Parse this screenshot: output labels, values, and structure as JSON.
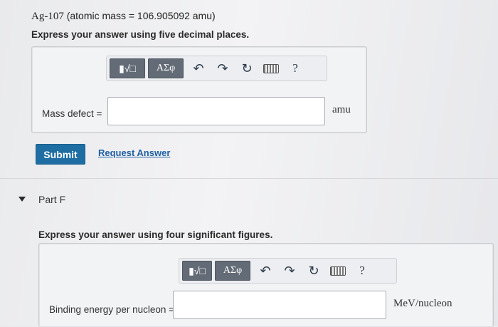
{
  "part_e": {
    "question": {
      "isotope": "Ag-107",
      "mass_text": "(atomic mass = 106.905092 amu)"
    },
    "instruction": "Express your answer using five decimal places.",
    "toolbar": {
      "template_label": "▮√□",
      "greek_label": "AΣφ",
      "help_label": "?"
    },
    "answer": {
      "label": "Mass defect =",
      "value": "",
      "unit": "amu"
    },
    "submit_label": "Submit",
    "request_label": "Request Answer"
  },
  "part_f": {
    "title": "Part F",
    "instruction": "Express your answer using four significant figures.",
    "toolbar": {
      "template_label": "▮√□",
      "greek_label": "AΣφ",
      "help_label": "?"
    },
    "answer": {
      "label": "Binding energy per nucleon =",
      "value": "",
      "unit": "MeV/nucleon"
    }
  }
}
